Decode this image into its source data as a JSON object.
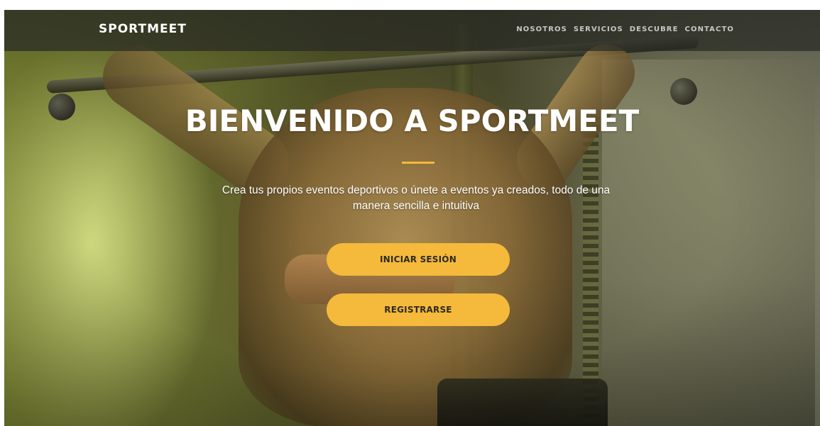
{
  "navbar": {
    "brand": "SPORTMEET",
    "links": [
      {
        "label": "NOSOTROS"
      },
      {
        "label": "SERVICIOS"
      },
      {
        "label": "DESCUBRE"
      },
      {
        "label": "CONTACTO"
      }
    ]
  },
  "hero": {
    "title": "BIENVENIDO A SPORTMEET",
    "subtitle_line1": "Crea tus propios eventos deportivos o únete a eventos ya creados, todo de una",
    "subtitle_line2": "manera sencilla e intuitiva",
    "login_label": "INICIAR SESIÓN",
    "register_label": "REGISTRARSE",
    "background_image": "woman-lat-pulldown-gym-photo"
  },
  "colors": {
    "accent": "#f5b93b",
    "navbar_bg": "rgba(40,42,36,0.72)",
    "text": "#ffffff",
    "button_text": "#2c2a20"
  }
}
